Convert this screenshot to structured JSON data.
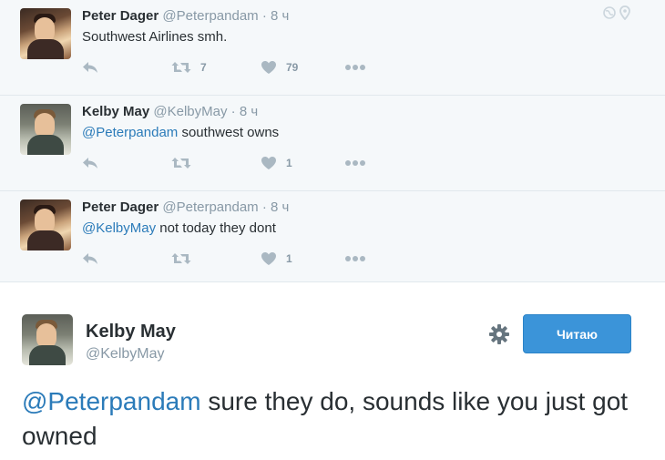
{
  "thread": [
    {
      "author_name": "Peter Dager",
      "author_handle": "@Peterpandam",
      "separator": "·",
      "time": "8 ч",
      "mention": "",
      "text": "Southwest Airlines smh.",
      "retweets": "7",
      "likes": "79"
    },
    {
      "author_name": "Kelby May",
      "author_handle": "@KelbyMay",
      "separator": "·",
      "time": "8 ч",
      "mention": "@Peterpandam",
      "text": " southwest owns",
      "retweets": "",
      "likes": "1"
    },
    {
      "author_name": "Peter Dager",
      "author_handle": "@Peterpandam",
      "separator": "·",
      "time": "8 ч",
      "mention": "@KelbyMay",
      "text": " not today they dont",
      "retweets": "",
      "likes": "1"
    }
  ],
  "main_tweet": {
    "author_name": "Kelby May",
    "author_handle": "@KelbyMay",
    "follow_label": "Читаю",
    "mention": "@Peterpandam",
    "text": " sure they do, sounds like you just got owned"
  },
  "icons": {
    "reply": "reply-icon",
    "retweet": "retweet-icon",
    "like": "heart-icon",
    "more": "more-icon",
    "globe": "globe-icon",
    "location": "location-pin-icon",
    "settings": "gear-icon"
  },
  "colors": {
    "link": "#2b7bb9",
    "muted": "#8899a6",
    "action": "#aab8c2",
    "follow_button": "#3b94d9",
    "thread_background": "#f5f8fa"
  }
}
